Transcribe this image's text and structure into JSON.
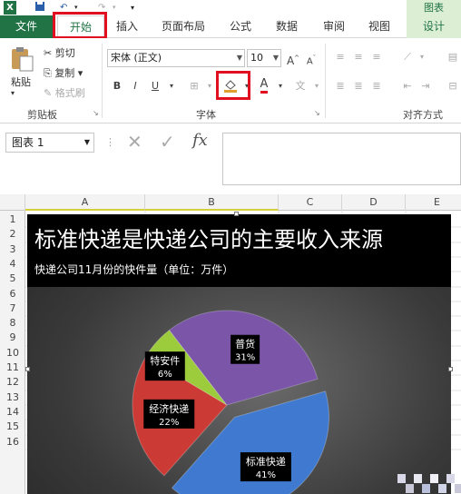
{
  "titlebar": {
    "context_tab": "图表",
    "undo": "↶",
    "redo": "↷"
  },
  "tabs": [
    "文件",
    "开始",
    "插入",
    "页面布局",
    "公式",
    "数据",
    "审阅",
    "视图",
    "设计"
  ],
  "ribbon": {
    "clipboard": {
      "paste": "粘贴",
      "cut": "剪切",
      "copy": "复制",
      "format_painter": "格式刷",
      "label": "剪贴板"
    },
    "font": {
      "name": "宋体 (正文)",
      "size": "10",
      "bold": "B",
      "italic": "I",
      "underline": "U",
      "label": "字体"
    },
    "alignment": {
      "label": "对齐方式"
    }
  },
  "formula_bar": {
    "name_box": "图表 1",
    "fx": "fx"
  },
  "columns": [
    "A",
    "B",
    "C",
    "D",
    "E"
  ],
  "rows": [
    "1",
    "2",
    "3",
    "4",
    "5",
    "6",
    "7",
    "8",
    "9",
    "10",
    "11",
    "12",
    "13",
    "14",
    "15",
    "16"
  ],
  "chart_data": {
    "type": "pie",
    "title": "标准快递是快递公司的主要收入来源",
    "subtitle": "快递公司11月份的快件量（单位：万件）",
    "categories": [
      "标准快递",
      "经济快递",
      "特安件",
      "普货"
    ],
    "values": [
      41,
      22,
      6,
      31
    ],
    "labels": [
      "41%",
      "22%",
      "6%",
      "31%"
    ],
    "colors": [
      "#3f7ad0",
      "#cc3a35",
      "#9ccc3c",
      "#7a55a8"
    ],
    "exploded": "标准快递"
  }
}
